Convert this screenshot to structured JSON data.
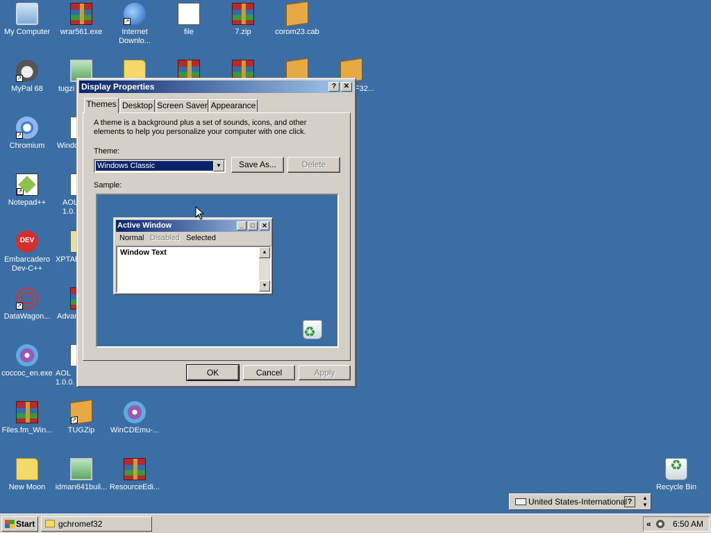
{
  "desktop": {
    "icons": [
      {
        "label": "My Computer"
      },
      {
        "label": "wrar561.exe"
      },
      {
        "label": "Internet Downlo..."
      },
      {
        "label": "file"
      },
      {
        "label": "7.zip"
      },
      {
        "label": "corom23.cab"
      },
      {
        "label": "MyPal 68"
      },
      {
        "label": "tugzi"
      },
      {
        "label": "F32..."
      },
      {
        "label": "Chromium"
      },
      {
        "label": "Windo"
      },
      {
        "label": "Notepad++"
      },
      {
        "label": "AOL 1.0."
      },
      {
        "label": "Embarcadero Dev-C++"
      },
      {
        "label": "XPTAB"
      },
      {
        "label": "DataWagon..."
      },
      {
        "label": "Advan"
      },
      {
        "label": "coccoc_en.exe"
      },
      {
        "label": "AOL 1.0.0."
      },
      {
        "label": "Files.fm_Win..."
      },
      {
        "label": "TUGZip"
      },
      {
        "label": "WinCDEmu-..."
      },
      {
        "label": "New Moon"
      },
      {
        "label": "idman641buil..."
      },
      {
        "label": "ResourceEdi..."
      },
      {
        "label": "Recycle Bin"
      }
    ]
  },
  "dialog": {
    "title": "Display Properties",
    "help_glyph": "?",
    "close_glyph": "✕",
    "tabs": [
      {
        "label": "Themes"
      },
      {
        "label": "Desktop"
      },
      {
        "label": "Screen Saver"
      },
      {
        "label": "Appearance"
      }
    ],
    "description": "A theme is a background plus a set of sounds, icons, and other elements to help you personalize your computer with one click.",
    "theme_label": "Theme:",
    "theme_value": "Windows Classic",
    "save_as": "Save As...",
    "delete": "Delete",
    "sample_label": "Sample:",
    "sample": {
      "title": "Active Window",
      "menu": [
        "Normal",
        "Disabled",
        "Selected"
      ],
      "text": "Window Text"
    },
    "ok": "OK",
    "cancel": "Cancel",
    "apply": "Apply"
  },
  "taskbar": {
    "start": "Start",
    "task": "gchromef32",
    "clock": "6:50 AM"
  },
  "language_bar": {
    "label": "United States-International"
  }
}
